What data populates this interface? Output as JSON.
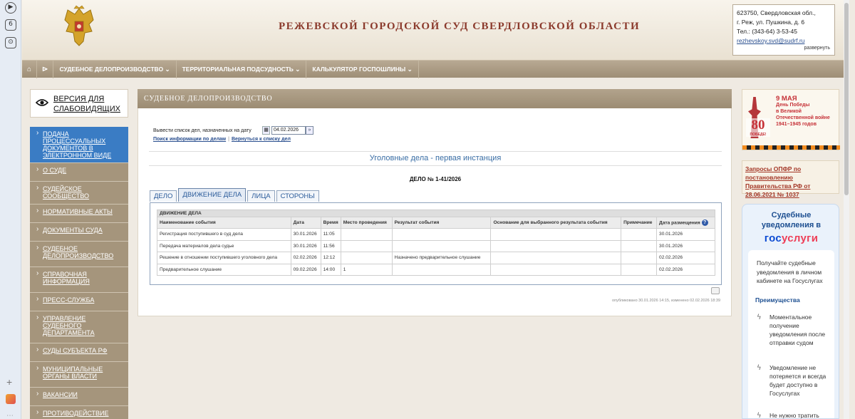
{
  "browser": {
    "icons": [
      "play-icon",
      "tab-count-icon",
      "screenshot-icon",
      "add-icon",
      "app-icon",
      "more-icon"
    ],
    "tab_count": "6"
  },
  "header": {
    "court_title": "РЕЖЕВСКОЙ ГОРОДСКОЙ СУД СВЕРДЛОВСКОЙ ОБЛАСТИ",
    "contact": {
      "line1": "623750, Свердловская обл.,",
      "line2": "г. Реж, ул. Пушкина, д. 6",
      "phone": "Тел.: (343-64) 3-53-45",
      "email": "rezhevskoy.svd@sudrf.ru",
      "expand": "развернуть"
    }
  },
  "nav": {
    "home_icon": "⌂",
    "arrow_icon": "⊳",
    "items": [
      "СУДЕБНОЕ ДЕЛОПРОИЗВОДСТВО ⌄",
      "ТЕРРИТОРИАЛЬНАЯ ПОДСУДНОСТЬ ⌄",
      "КАЛЬКУЛЯТОР ГОСПОШЛИНЫ ⌄"
    ]
  },
  "accessibility": {
    "label_line1": "ВЕРСИЯ ДЛЯ",
    "label_line2": "СЛАБОВИДЯЩИХ"
  },
  "sidebar": {
    "items": [
      "ПОДАЧА ПРОЦЕССУАЛЬНЫХ ДОКУМЕНТОВ В ЭЛЕКТРОННОМ ВИДЕ",
      "О СУДЕ",
      "СУДЕЙСКОЕ СООБЩЕСТВО",
      "НОРМАТИВНЫЕ АКТЫ",
      "ДОКУМЕНТЫ СУДА",
      "СУДЕБНОЕ ДЕЛОПРОИЗВОДСТВО",
      "СПРАВОЧНАЯ ИНФОРМАЦИЯ",
      "ПРЕСС-СЛУЖБА",
      "УПРАВЛЕНИЕ СУДЕБНОГО ДЕПАРТАМЕНТА",
      "СУДЫ СУБЪЕКТА РФ",
      "МУНИЦИПАЛЬНЫЕ ОРГАНЫ ВЛАСТИ",
      "ВАКАНСИИ",
      "ПРОТИВОДЕЙСТВИЕ"
    ]
  },
  "main": {
    "section_title": "СУДЕБНОЕ ДЕЛОПРОИЗВОДСТВО",
    "date_label": "Вывести список дел, назначенных на дату",
    "date_value": "04.02.2026",
    "date_go": "»",
    "link_search": "Поиск информации по делам",
    "link_sep": "|",
    "link_back": "Вернуться к списку дел",
    "case_type": "Уголовные дела - первая инстанция",
    "case_number": "ДЕЛО № 1-41/2026",
    "tabs": [
      "ДЕЛО",
      "ДВИЖЕНИЕ ДЕЛА",
      "ЛИЦА",
      "СТОРОНЫ"
    ],
    "table": {
      "caption": "ДВИЖЕНИЕ ДЕЛА",
      "headers": [
        "Наименование события",
        "Дата",
        "Время",
        "Место проведения",
        "Результат события",
        "Основание для выбранного результата события",
        "Примечание",
        "Дата размещения"
      ],
      "help_icon": "?",
      "rows": [
        [
          "Регистрация поступившего в суд дела",
          "30.01.2026",
          "11:05",
          "",
          "",
          "",
          "",
          "30.01.2026"
        ],
        [
          "Передача материалов дела судье",
          "30.01.2026",
          "11:56",
          "",
          "",
          "",
          "",
          "30.01.2026"
        ],
        [
          "Решение в отношении поступившего уголовного дела",
          "02.02.2026",
          "12:12",
          "",
          "Назначено предварительное слушание",
          "",
          "",
          "02.02.2026"
        ],
        [
          "Предварительное слушание",
          "09.02.2026",
          "14:00",
          "1",
          "",
          "",
          "",
          "02.02.2026"
        ]
      ]
    },
    "pub_info": "опубликовано 30.01.2026 14:15, изменено 02.02.2026 18:39"
  },
  "right": {
    "victory": {
      "title": "9 МАЯ",
      "line1": "День Победы",
      "line2": "в Великой",
      "line3": "Отечественной войне",
      "line4": "1941–1945 годов",
      "num": "80",
      "pobeda": "ПОБЕДЕ!"
    },
    "opfr": "Запросы ОПФР по постановлению Правительства РФ от 28.06.2021 № 1037",
    "gosuslugi": {
      "title_line1": "Судебные",
      "title_line2": "уведомления в",
      "logo_part1": "гос",
      "logo_part2": "услуги",
      "intro": "Получайте судебные уведомления в личном кабинете на Госуслугах",
      "advantages": "Преимущества",
      "items": [
        "Моментальное получение уведомления после отправки судом",
        "Уведомление не потеряется и всегда будет доступно в Госуслугах",
        "Не нужно тратить"
      ]
    }
  }
}
